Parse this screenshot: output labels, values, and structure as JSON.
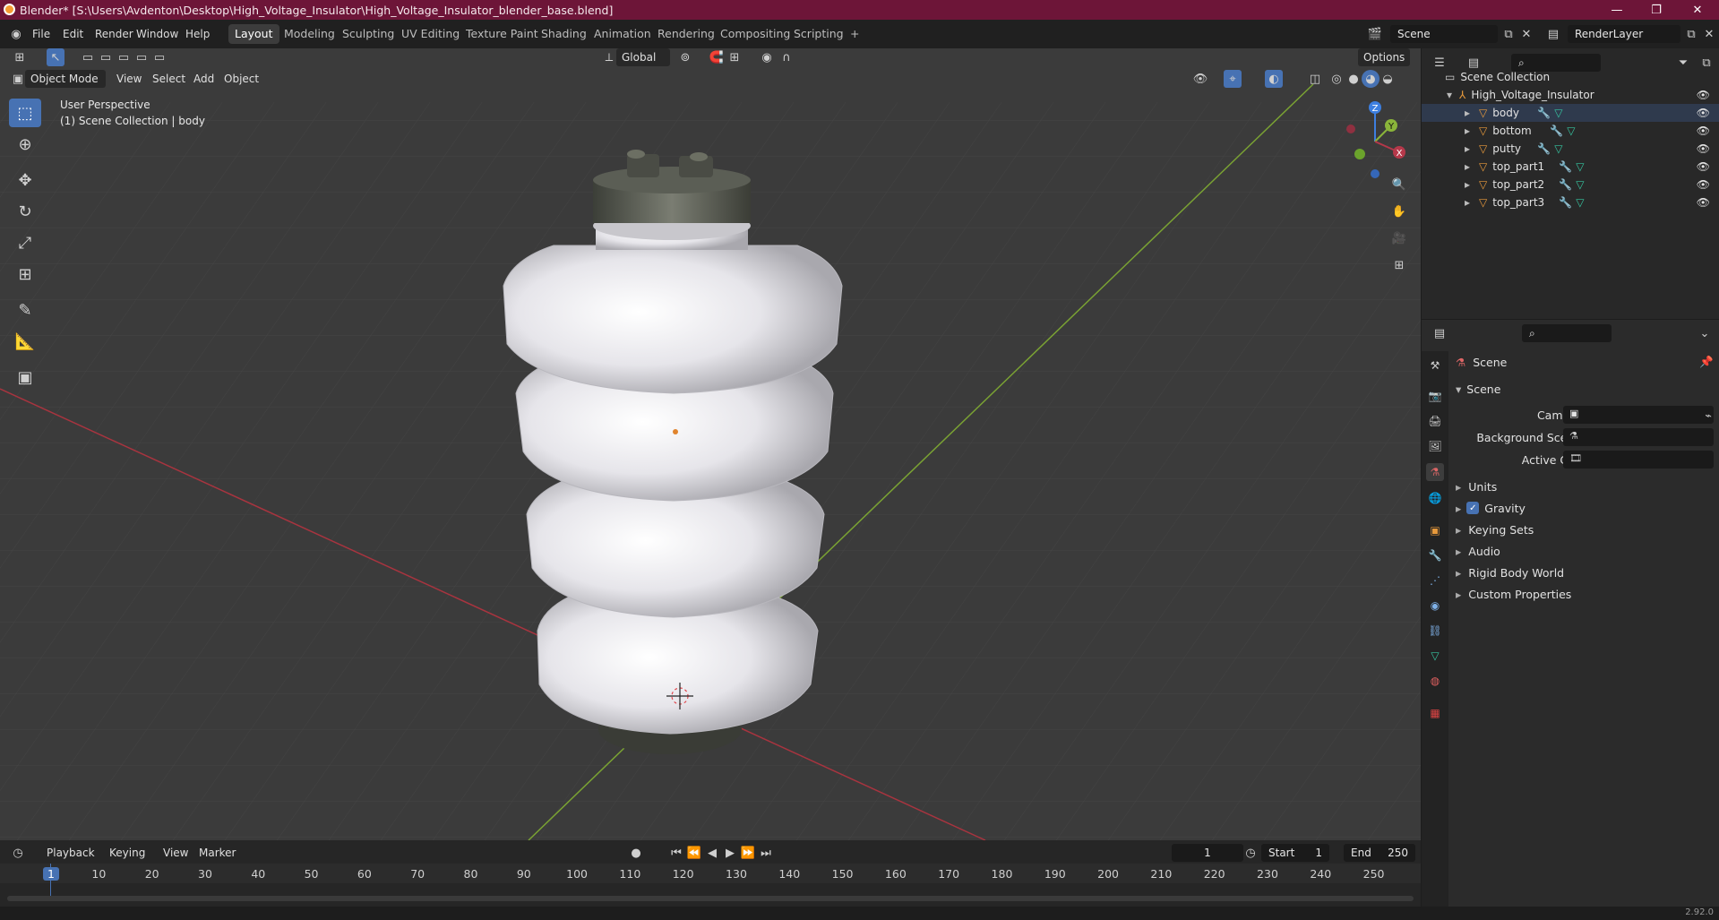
{
  "window": {
    "title": "Blender* [S:\\Users\\Avdenton\\Desktop\\High_Voltage_Insulator\\High_Voltage_Insulator_blender_base.blend]",
    "controls": [
      "—",
      "❐",
      "✕"
    ]
  },
  "menu": [
    "File",
    "Edit",
    "Render",
    "Window",
    "Help"
  ],
  "workspaces": [
    {
      "label": "Layout",
      "active": true
    },
    {
      "label": "Modeling"
    },
    {
      "label": "Sculpting"
    },
    {
      "label": "UV Editing"
    },
    {
      "label": "Texture Paint"
    },
    {
      "label": "Shading"
    },
    {
      "label": "Animation"
    },
    {
      "label": "Rendering"
    },
    {
      "label": "Compositing"
    },
    {
      "label": "Scripting"
    }
  ],
  "add_workspace": "+",
  "scene_selector": {
    "value": "Scene"
  },
  "layer_selector": {
    "value": "RenderLayer"
  },
  "viewport": {
    "transform_orientation": "Global",
    "options_label": "Options",
    "mode": "Object Mode",
    "header_menus": [
      "View",
      "Select",
      "Add",
      "Object"
    ],
    "overlay_title": "User Perspective",
    "overlay_subtitle": "(1) Scene Collection | body",
    "gizmo_axes": {
      "z": "Z",
      "y": "Y",
      "x": "X"
    }
  },
  "tools": [
    {
      "name": "select-box-tool",
      "glyph": "⬚",
      "active": true
    },
    {
      "name": "cursor-tool",
      "glyph": "⊕"
    },
    {
      "name": "move-tool",
      "glyph": "✥"
    },
    {
      "name": "rotate-tool",
      "glyph": "↻"
    },
    {
      "name": "scale-tool",
      "glyph": "⤢"
    },
    {
      "name": "transform-tool",
      "glyph": "⊞"
    },
    {
      "name": "annotate-tool",
      "glyph": "✎"
    },
    {
      "name": "measure-tool",
      "glyph": "📐"
    },
    {
      "name": "add-cube-tool",
      "glyph": "▣"
    }
  ],
  "outliner": {
    "root": "Scene Collection",
    "collection": "High_Voltage_Insulator",
    "objects": [
      "body",
      "bottom",
      "putty",
      "top_part1",
      "top_part2",
      "top_part3"
    ]
  },
  "properties": {
    "context": "Scene",
    "panel": "Scene",
    "fields": [
      {
        "label": "Camera",
        "value": ""
      },
      {
        "label": "Background Scene",
        "value": ""
      },
      {
        "label": "Active Clip",
        "value": ""
      }
    ],
    "subpanels": [
      {
        "label": "Units"
      },
      {
        "label": "Gravity",
        "checkbox": true
      },
      {
        "label": "Keying Sets"
      },
      {
        "label": "Audio"
      },
      {
        "label": "Rigid Body World"
      },
      {
        "label": "Custom Properties"
      }
    ]
  },
  "timeline": {
    "menus": [
      "Playback",
      "Keying",
      "View",
      "Marker"
    ],
    "current_frame": "1",
    "start_label": "Start",
    "start": "1",
    "end_label": "End",
    "end": "250",
    "ticks": [
      "1",
      "10",
      "20",
      "30",
      "40",
      "50",
      "60",
      "70",
      "80",
      "90",
      "100",
      "110",
      "120",
      "130",
      "140",
      "150",
      "160",
      "170",
      "180",
      "190",
      "200",
      "210",
      "220",
      "230",
      "240",
      "250"
    ]
  },
  "status": {
    "version": "2.92.0"
  },
  "colors": {
    "title_bar": "#6d1538",
    "accent": "#4772b3",
    "x_axis": "#b5384a",
    "y_axis": "#8ab43a",
    "z_axis": "#3d7fe0"
  }
}
